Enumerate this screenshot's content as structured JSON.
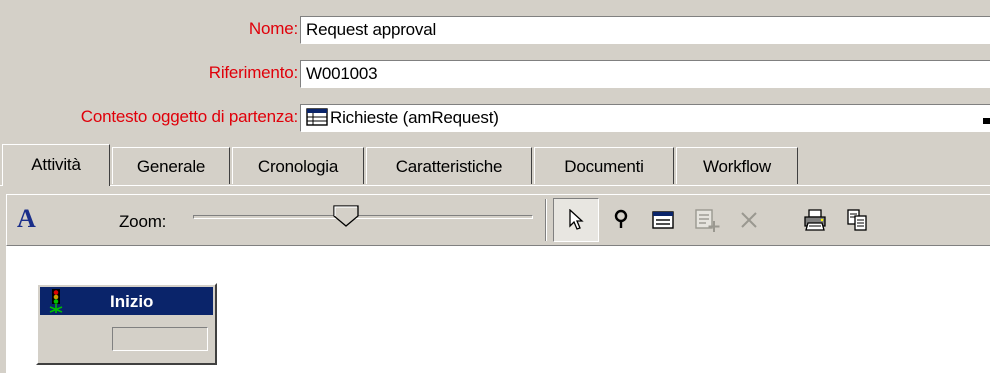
{
  "form": {
    "name_label": "Nome:",
    "name_value": "Request approval",
    "ref_label": "Riferimento:",
    "ref_value": "W001003",
    "context_label": "Contesto oggetto di partenza:",
    "context_value": "Richieste (amRequest)",
    "context_icon": "table-icon",
    "label_color": "#e0000a"
  },
  "tabs": [
    {
      "label": "Attività",
      "active": true
    },
    {
      "label": "Generale",
      "active": false
    },
    {
      "label": "Cronologia",
      "active": false
    },
    {
      "label": "Caratteristiche",
      "active": false
    },
    {
      "label": "Documenti",
      "active": false
    },
    {
      "label": "Workflow",
      "active": false
    }
  ],
  "toolbar": {
    "font_button": "A",
    "zoom_label": "Zoom:",
    "zoom_level": 0.45,
    "icons": [
      "font-icon",
      "pointer-icon",
      "link-icon",
      "properties-icon",
      "add-activity-icon",
      "delete-icon",
      "print-icon",
      "copy-icon"
    ]
  },
  "canvas": {
    "node_title": "Inizio",
    "node_icon": "traffic-light-icon",
    "node_header_color": "#0a246a"
  }
}
